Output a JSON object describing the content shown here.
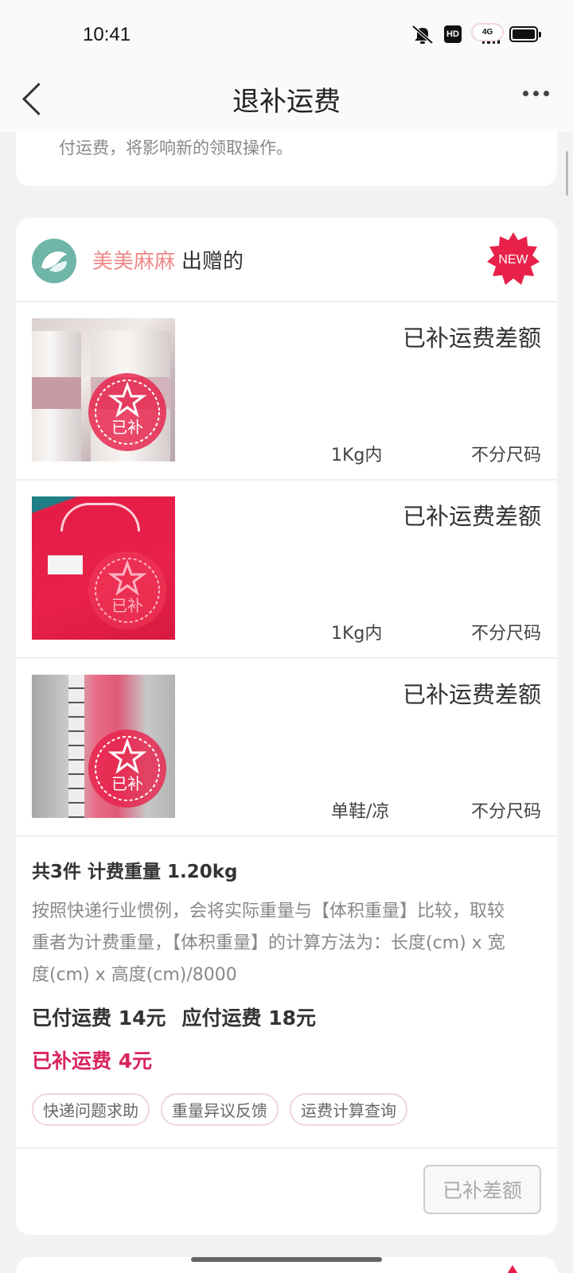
{
  "status_bar": {
    "time": "10:41",
    "hd_label": "HD",
    "network_label": "4G",
    "icons": [
      "mute-icon",
      "hd-icon",
      "signal-icon",
      "battery-icon"
    ]
  },
  "nav": {
    "title": "退补运费",
    "icons": [
      "back-icon",
      "more-icon"
    ]
  },
  "notice": {
    "text": "付运费，将影响新的领取操作。"
  },
  "card": {
    "donor_name": "美美麻麻",
    "donor_suffix": "出赠的",
    "new_badge": "NEW",
    "stamp_label": "已补",
    "items": [
      {
        "status": "已补运费差额",
        "weight": "1Kg内",
        "size": "不分尺码"
      },
      {
        "status": "已补运费差额",
        "weight": "1Kg内",
        "size": "不分尺码"
      },
      {
        "status": "已补运费差额",
        "weight": "单鞋/凉",
        "size": "不分尺码"
      }
    ],
    "summary": {
      "title": "共3件 计费重量 1.20kg",
      "description": "按照快递行业惯例，会将实际重量与【体积重量】比较，取较重者为计费重量，【体积重量】的计算方法为：长度(cm) x 宽度(cm) x 高度(cm)/8000",
      "paid": "已付运费 14元",
      "due": "应付运费 18元",
      "refund": "已补运费 4元"
    },
    "tags": [
      "快递问题求助",
      "重量异议反馈",
      "运费计算查询"
    ],
    "done_button": "已补差额"
  },
  "colors": {
    "accent_red": "#d9245d",
    "donor_pink": "#ee8a8a",
    "stamp_red": "#e8214a"
  }
}
